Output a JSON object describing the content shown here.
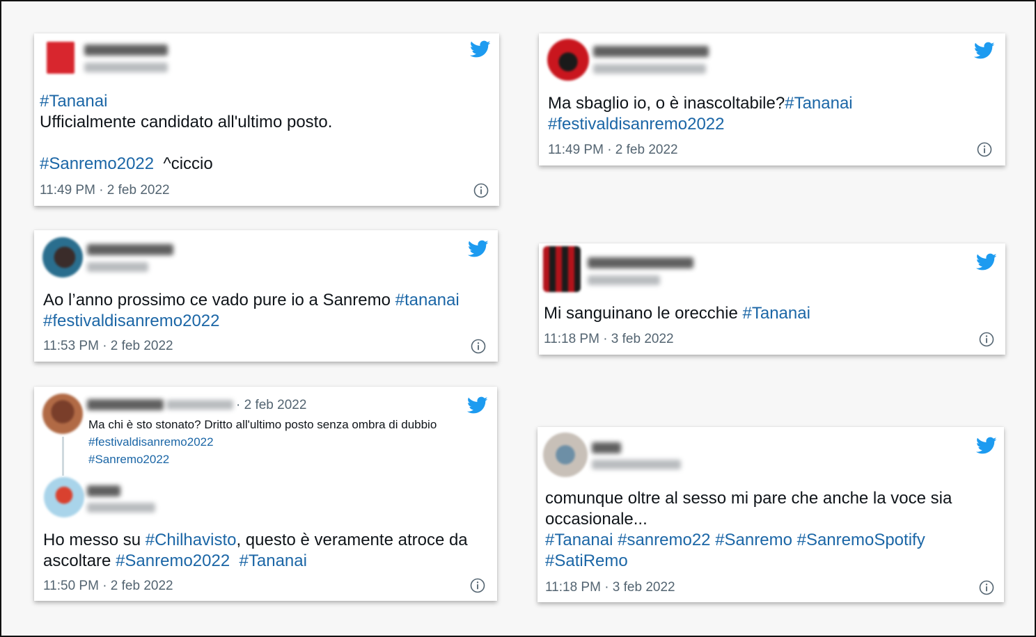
{
  "colors": {
    "hashtag": "#1b66a6",
    "twitter": "#1d9bf0",
    "meta": "#536471"
  },
  "icons": {
    "platform": "twitter-bird-icon",
    "info": "info-circle-icon"
  },
  "tweets": [
    {
      "id": "t1",
      "text": [
        {
          "t": "#Tananai",
          "h": true
        },
        {
          "t": "\nUfficialmente candidato all'ultimo posto.\n\n"
        },
        {
          "t": "#Sanremo2022",
          "h": true
        },
        {
          "t": "  ^ciccio"
        }
      ],
      "timestamp": "11:49 PM · 2 feb 2022"
    },
    {
      "id": "t2",
      "text": [
        {
          "t": "Ma sbaglio io, o è inascoltabile?"
        },
        {
          "t": "#Tananai",
          "h": true
        },
        {
          "t": "\n"
        },
        {
          "t": "#festivaldisanremo2022",
          "h": true
        }
      ],
      "timestamp": "11:49 PM · 2 feb 2022"
    },
    {
      "id": "t3",
      "text": [
        {
          "t": "Ao l’anno prossimo ce vado pure io a Sanremo "
        },
        {
          "t": "#tananai",
          "h": true
        },
        {
          "t": "\n"
        },
        {
          "t": "#festivaldisanremo2022",
          "h": true
        }
      ],
      "timestamp": "11:53 PM · 2 feb 2022"
    },
    {
      "id": "t4",
      "text": [
        {
          "t": "Mi sanguinano le orecchie "
        },
        {
          "t": "#Tananai",
          "h": true
        }
      ],
      "timestamp": "11:18 PM · 3 feb 2022"
    },
    {
      "id": "t5",
      "quoted": {
        "date": "· 2 feb 2022",
        "text": [
          {
            "t": "Ma chi è sto stonato? Dritto all'ultimo posto senza ombra di dubbio\n"
          },
          {
            "t": "#festivaldisanremo2022",
            "h": true
          },
          {
            "t": "\n"
          },
          {
            "t": "#Sanremo2022",
            "h": true
          }
        ]
      },
      "text": [
        {
          "t": "Ho messo su "
        },
        {
          "t": "#Chilhavisto",
          "h": true
        },
        {
          "t": ", questo è veramente atroce da\nascoltare "
        },
        {
          "t": "#Sanremo2022",
          "h": true
        },
        {
          "t": "  "
        },
        {
          "t": "#Tananai",
          "h": true
        }
      ],
      "timestamp": "11:50 PM · 2 feb 2022"
    },
    {
      "id": "t6",
      "text": [
        {
          "t": "comunque oltre al sesso mi pare che anche la voce sia\noccasionale...\n"
        },
        {
          "t": "#Tananai",
          "h": true
        },
        {
          "t": " "
        },
        {
          "t": "#sanremo22",
          "h": true
        },
        {
          "t": " "
        },
        {
          "t": "#Sanremo",
          "h": true
        },
        {
          "t": " "
        },
        {
          "t": "#SanremoSpotify",
          "h": true
        },
        {
          "t": "\n"
        },
        {
          "t": "#SatiRemo",
          "h": true
        }
      ],
      "timestamp": "11:18 PM · 3 feb 2022"
    }
  ]
}
